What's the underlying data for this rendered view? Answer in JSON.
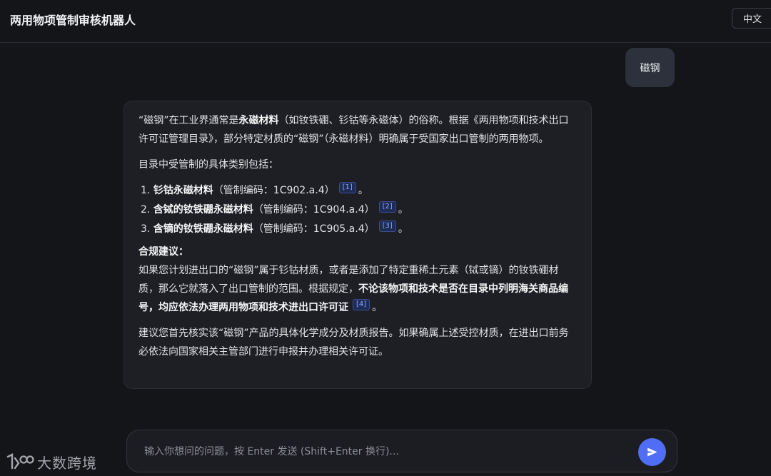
{
  "header": {
    "title": "两用物项管制审核机器人",
    "lang_button": "中文"
  },
  "user_message": "磁钢",
  "bot": {
    "intro": [
      {
        "t": "“磁钢”在工业界通常是",
        "b": false
      },
      {
        "t": "永磁材料",
        "b": true
      },
      {
        "t": "（如钕铁硼、钐钴等永磁体）的俗称。根据《两用物项和技术出口许可证管理目录》，部分特定材质的“磁钢”（永磁材料）明确属于受国家出口管制的两用物项。",
        "b": false
      }
    ],
    "categories_heading": "目录中受管制的具体类别包括：",
    "categories": [
      {
        "num": "1.",
        "name": "钐钴永磁材料",
        "code": "（管制编码：1C902.a.4）",
        "cite": "[1]",
        "end": "。"
      },
      {
        "num": "2.",
        "name": "含铽的钕铁硼永磁材料",
        "code": "（管制编码：1C904.a.4）",
        "cite": "[2]",
        "end": "。"
      },
      {
        "num": "3.",
        "name": "含镝的钕铁硼永磁材料",
        "code": "（管制编码：1C905.a.4）",
        "cite": "[3]",
        "end": "。"
      }
    ],
    "advice_title": "合规建议：",
    "advice_plain": "如果您计划进出口的“磁钢”属于钐钴材质，或者是添加了特定重稀土元素（铽或镝）的钕铁硼材质，那么它就落入了出口管制的范围。根据规定，",
    "advice_bold": "不论该物项和技术是否在目录中列明海关商品编号，均应依法办理两用物项和技术进出口许可证",
    "advice_cite": "[4]",
    "advice_end": "。",
    "final": "建议您首先核实该“磁钢”产品的具体化学成分及材质报告。如果确属上述受控材质，在进出口前务必依法向国家相关主管部门进行申报并办理相关许可证。"
  },
  "input": {
    "placeholder": "输入你想问的问题，按 Enter 发送 (Shift+Enter 换行)...",
    "value": ""
  },
  "watermark": {
    "logo_text": "大数跨境"
  },
  "colors": {
    "background": "#141519",
    "card": "#1e1f24",
    "user_bubble": "#2c313c",
    "send_button": "#4f6df5",
    "citation": "#8aa6ff"
  }
}
